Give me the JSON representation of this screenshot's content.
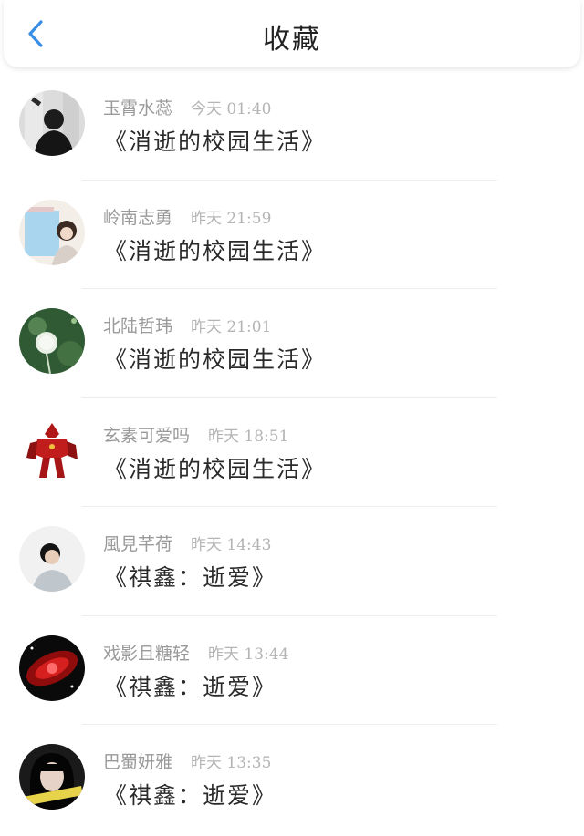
{
  "header": {
    "title": "收藏",
    "back_icon": "chevron-left-icon",
    "accent_color": "#3a8ee6"
  },
  "items": [
    {
      "name": "玉霄水蕊",
      "time": "今天 01:40",
      "message": "《消逝的校园生活》",
      "avatar_icon": "avatar-girl-mirror"
    },
    {
      "name": "岭南志勇",
      "time": "昨天 21:59",
      "message": "《消逝的校园生活》",
      "avatar_icon": "avatar-girl-blue"
    },
    {
      "name": "北陆哲玮",
      "time": "昨天 21:01",
      "message": "《消逝的校园生活》",
      "avatar_icon": "avatar-dandelion"
    },
    {
      "name": "玄素可爱吗",
      "time": "昨天 18:51",
      "message": "《消逝的校园生活》",
      "avatar_icon": "avatar-red-robot"
    },
    {
      "name": "風見芊荷",
      "time": "昨天 14:43",
      "message": "《祺鑫：逝爱》",
      "avatar_icon": "avatar-boy"
    },
    {
      "name": "戏影且糖轻",
      "time": "昨天 13:44",
      "message": "《祺鑫：逝爱》",
      "avatar_icon": "avatar-red-galaxy"
    },
    {
      "name": "巴蜀妍雅",
      "time": "昨天 13:35",
      "message": "《祺鑫：逝爱》",
      "avatar_icon": "avatar-girl-caption"
    }
  ]
}
